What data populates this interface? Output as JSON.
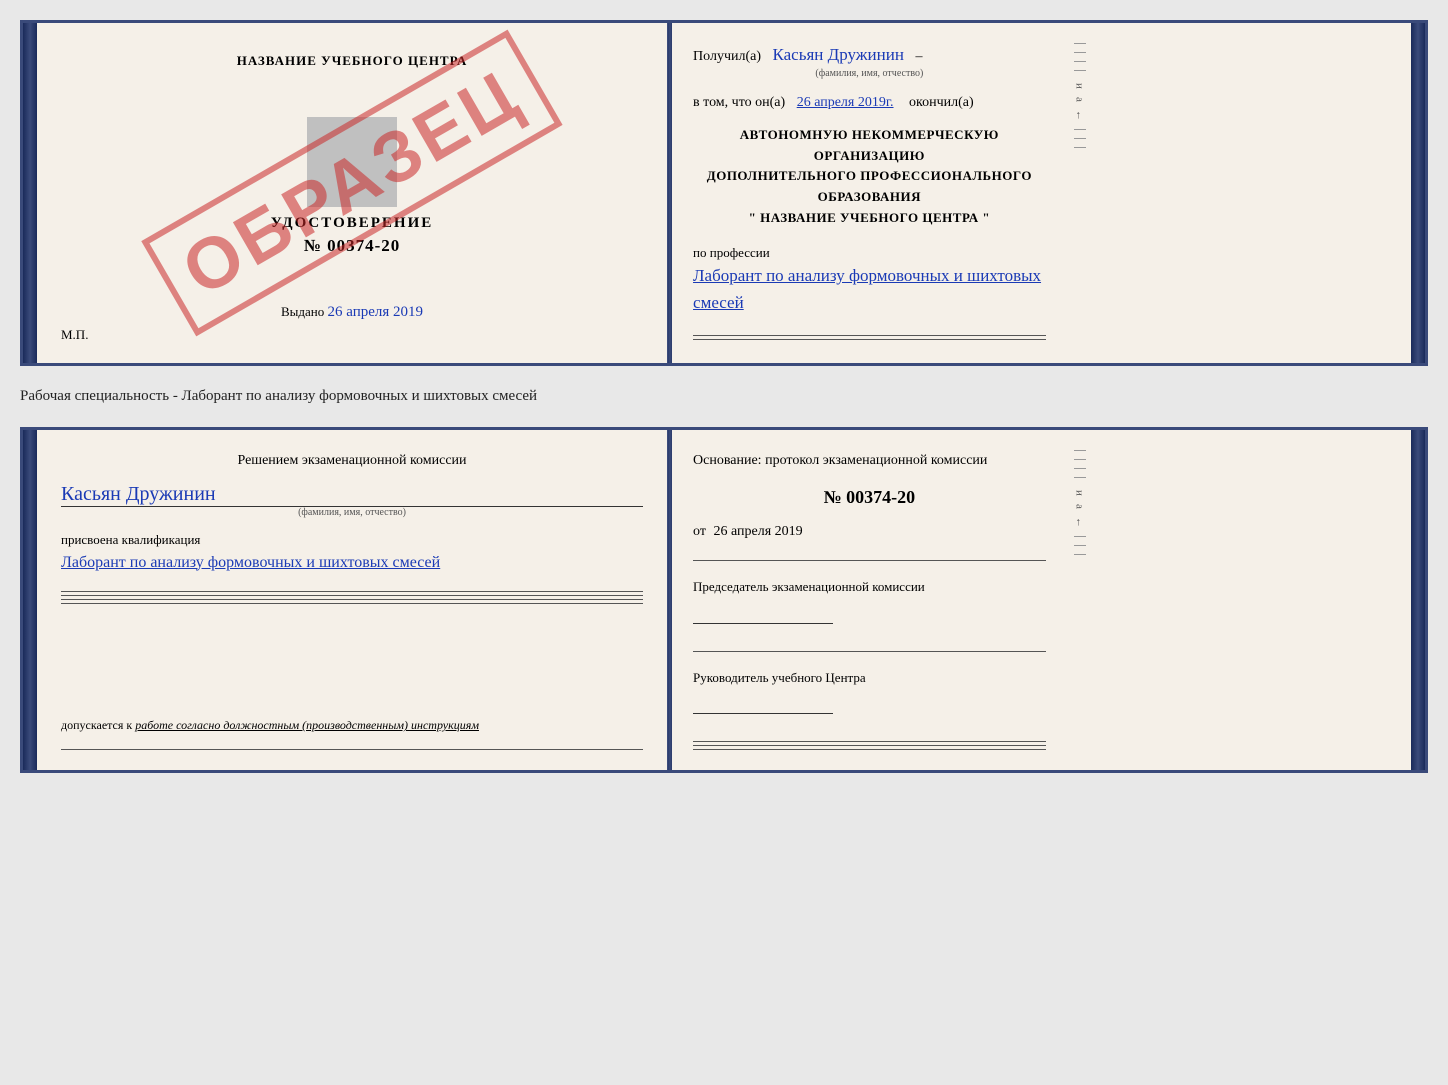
{
  "topCard": {
    "left": {
      "title": "НАЗВАНИЕ УЧЕБНОГО ЦЕНТРА",
      "stamp": "ОБРАЗЕЦ",
      "certificateLabel": "УДОСТОВЕРЕНИЕ",
      "certNumber": "№ 00374-20",
      "issuedLabel": "Выдано",
      "issuedDate": "26 апреля 2019",
      "mpLabel": "М.П."
    },
    "right": {
      "poluchilLabel": "Получил(а)",
      "nameHandwritten": "Касьян Дружинин",
      "nameSublabel": "(фамилия, имя, отчество)",
      "vtomLabel": "в том, что он(а)",
      "vtomDate": "26 апреля 2019г.",
      "okonchilLabel": "окончил(а)",
      "orgLine1": "АВТОНОМНУЮ НЕКОММЕРЧЕСКУЮ ОРГАНИЗАЦИЮ",
      "orgLine2": "ДОПОЛНИТЕЛЬНОГО ПРОФЕССИОНАЛЬНОГО ОБРАЗОВАНИЯ",
      "orgLine3": "\"   НАЗВАНИЕ УЧЕБНОГО ЦЕНТРА   \"",
      "profLabel": "по профессии",
      "profHandwritten": "Лаборант по анализу формовочных и шихтовых смесей"
    }
  },
  "middleText": "Рабочая специальность - Лаборант по анализу формовочных и шихтовых смесей",
  "bottomCard": {
    "left": {
      "reshenieHeader": "Решением  экзаменационной  комиссии",
      "nameHandwritten": "Касьян Дружинин",
      "nameSublabel": "(фамилия, имя, отчество)",
      "prisvoenaLabel": "присвоена квалификация",
      "kvaliHandwritten": "Лаборант по анализу формовочных и шихтовых смесей",
      "dopuskaetsyaLabel": "допускается к",
      "dopuskaetsyaText": "работе согласно должностным (производственным) инструкциям"
    },
    "right": {
      "osnovaLabel": "Основание: протокол экзаменационной  комиссии",
      "protocolNumber": "№  00374-20",
      "protocolDatePrefix": "от",
      "protocolDate": "26 апреля 2019",
      "predsedatelLabel": "Председатель экзаменационной комиссии",
      "rukovodityelLabel": "Руководитель учебного Центра"
    }
  }
}
